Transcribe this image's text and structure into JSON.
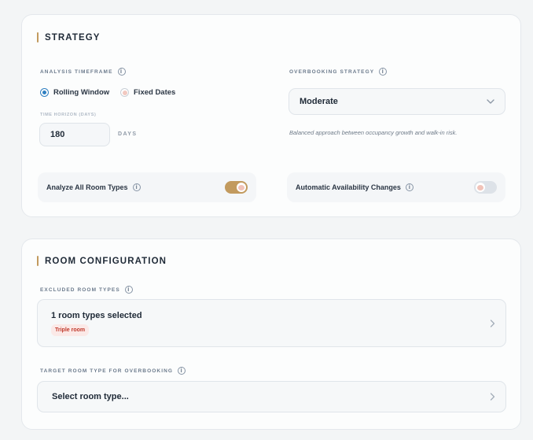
{
  "strategy": {
    "title": "STRATEGY",
    "timeframe": {
      "label": "ANALYSIS TIMEFRAME",
      "options": [
        "Rolling Window",
        "Fixed Dates"
      ],
      "selected": "Rolling Window"
    },
    "horizon": {
      "label": "TIME HORIZON (DAYS)",
      "value": "180",
      "unit": "DAYS"
    },
    "overbooking": {
      "label": "OVERBOOKING STRATEGY",
      "value": "Moderate",
      "help": "Balanced approach between occupancy growth and walk-in risk."
    },
    "toggles": [
      {
        "label": "Analyze All Room Types",
        "on": true
      },
      {
        "label": "Automatic Availability Changes",
        "on": false
      }
    ]
  },
  "room": {
    "title": "ROOM CONFIGURATION",
    "excluded": {
      "label": "EXCLUDED ROOM TYPES",
      "summary": "1 room types selected",
      "chips": [
        "Triple room"
      ]
    },
    "target": {
      "label": "TARGET ROOM TYPE FOR OVERBOOKING",
      "placeholder": "Select room type..."
    }
  },
  "colors": {
    "accent": "#c29a5e",
    "radio": "#2f7fc1",
    "chip_text": "#c0392b"
  }
}
